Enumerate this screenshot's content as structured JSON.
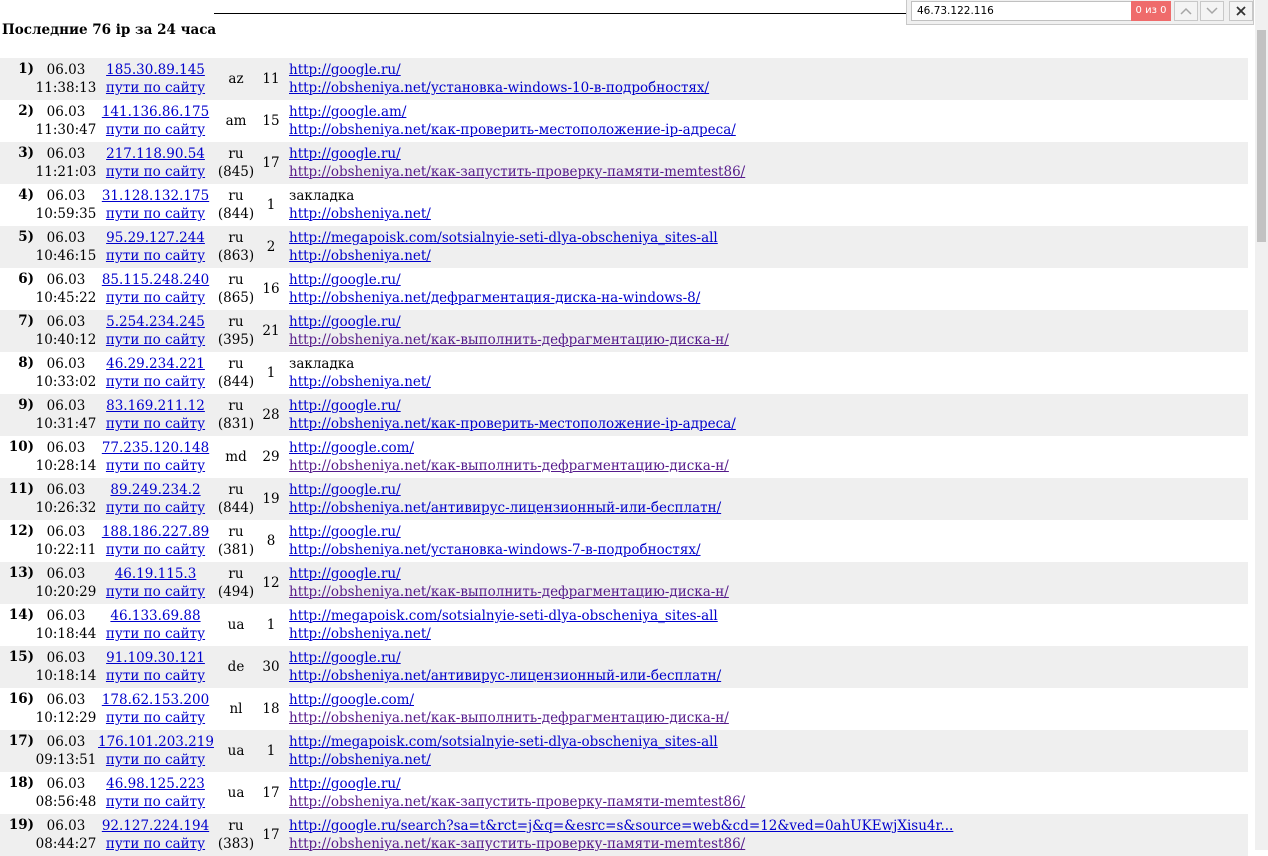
{
  "page": {
    "title": "Последние 76 ip за 24 часа"
  },
  "findbar": {
    "query": "46.73.122.116",
    "count": "0 из 0",
    "prev_icon": "chevron-up-icon",
    "next_icon": "chevron-down-icon",
    "close_icon": "close-icon"
  },
  "colors": {
    "link": "#0000cc",
    "visited": "#551a8b",
    "row_shade": "#efefef",
    "find_no_match": "#ef6b6b"
  },
  "rows": [
    {
      "num": "1)",
      "date": "06.03",
      "time": "11:38:13",
      "ip": "185.30.89.145",
      "paths": "пути по сайту",
      "cc": "az",
      "region": "",
      "count": "11",
      "ref1": "http://google.ru/",
      "ref1_link": true,
      "ref2": "http://obsheniya.net/установка-windows-10-в-подробностях/",
      "ref2_visited": false
    },
    {
      "num": "2)",
      "date": "06.03",
      "time": "11:30:47",
      "ip": "141.136.86.175",
      "paths": "пути по сайту",
      "cc": "am",
      "region": "",
      "count": "15",
      "ref1": "http://google.am/",
      "ref1_link": true,
      "ref2": "http://obsheniya.net/как-проверить-местоположение-ip-адреса/",
      "ref2_visited": false
    },
    {
      "num": "3)",
      "date": "06.03",
      "time": "11:21:03",
      "ip": "217.118.90.54",
      "paths": "пути по сайту",
      "cc": "ru",
      "region": "(845)",
      "count": "17",
      "ref1": "http://google.ru/",
      "ref1_link": true,
      "ref2": "http://obsheniya.net/как-запустить-проверку-памяти-memtest86/",
      "ref2_visited": true
    },
    {
      "num": "4)",
      "date": "06.03",
      "time": "10:59:35",
      "ip": "31.128.132.175",
      "paths": "пути по сайту",
      "cc": "ru",
      "region": "(844)",
      "count": "1",
      "ref1": "закладка",
      "ref1_link": false,
      "ref2": "http://obsheniya.net/",
      "ref2_visited": false
    },
    {
      "num": "5)",
      "date": "06.03",
      "time": "10:46:15",
      "ip": "95.29.127.244",
      "paths": "пути по сайту",
      "cc": "ru",
      "region": "(863)",
      "count": "2",
      "ref1": "http://megapoisk.com/sotsialnyie-seti-dlya-obscheniya_sites-all",
      "ref1_link": true,
      "ref2": "http://obsheniya.net/",
      "ref2_visited": false
    },
    {
      "num": "6)",
      "date": "06.03",
      "time": "10:45:22",
      "ip": "85.115.248.240",
      "paths": "пути по сайту",
      "cc": "ru",
      "region": "(865)",
      "count": "16",
      "ref1": "http://google.ru/",
      "ref1_link": true,
      "ref2": "http://obsheniya.net/дефрагментация-диска-на-windows-8/",
      "ref2_visited": false
    },
    {
      "num": "7)",
      "date": "06.03",
      "time": "10:40:12",
      "ip": "5.254.234.245",
      "paths": "пути по сайту",
      "cc": "ru",
      "region": "(395)",
      "count": "21",
      "ref1": "http://google.ru/",
      "ref1_link": true,
      "ref2": "http://obsheniya.net/как-выполнить-дефрагментацию-диска-н/",
      "ref2_visited": true
    },
    {
      "num": "8)",
      "date": "06.03",
      "time": "10:33:02",
      "ip": "46.29.234.221",
      "paths": "пути по сайту",
      "cc": "ru",
      "region": "(844)",
      "count": "1",
      "ref1": "закладка",
      "ref1_link": false,
      "ref2": "http://obsheniya.net/",
      "ref2_visited": false
    },
    {
      "num": "9)",
      "date": "06.03",
      "time": "10:31:47",
      "ip": "83.169.211.12",
      "paths": "пути по сайту",
      "cc": "ru",
      "region": "(831)",
      "count": "28",
      "ref1": "http://google.ru/",
      "ref1_link": true,
      "ref2": "http://obsheniya.net/как-проверить-местоположение-ip-адреса/",
      "ref2_visited": false
    },
    {
      "num": "10)",
      "date": "06.03",
      "time": "10:28:14",
      "ip": "77.235.120.148",
      "paths": "пути по сайту",
      "cc": "md",
      "region": "",
      "count": "29",
      "ref1": "http://google.com/",
      "ref1_link": true,
      "ref2": "http://obsheniya.net/как-выполнить-дефрагментацию-диска-н/",
      "ref2_visited": true
    },
    {
      "num": "11)",
      "date": "06.03",
      "time": "10:26:32",
      "ip": "89.249.234.2",
      "paths": "пути по сайту",
      "cc": "ru",
      "region": "(844)",
      "count": "19",
      "ref1": "http://google.ru/",
      "ref1_link": true,
      "ref2": "http://obsheniya.net/антивирус-лицензионный-или-бесплатн/",
      "ref2_visited": false
    },
    {
      "num": "12)",
      "date": "06.03",
      "time": "10:22:11",
      "ip": "188.186.227.89",
      "paths": "пути по сайту",
      "cc": "ru",
      "region": "(381)",
      "count": "8",
      "ref1": "http://google.ru/",
      "ref1_link": true,
      "ref2": "http://obsheniya.net/установка-windows-7-в-подробностях/",
      "ref2_visited": false
    },
    {
      "num": "13)",
      "date": "06.03",
      "time": "10:20:29",
      "ip": "46.19.115.3",
      "paths": "пути по сайту",
      "cc": "ru",
      "region": "(494)",
      "count": "12",
      "ref1": "http://google.ru/",
      "ref1_link": true,
      "ref2": "http://obsheniya.net/как-выполнить-дефрагментацию-диска-н/",
      "ref2_visited": true
    },
    {
      "num": "14)",
      "date": "06.03",
      "time": "10:18:44",
      "ip": "46.133.69.88",
      "paths": "пути по сайту",
      "cc": "ua",
      "region": "",
      "count": "1",
      "ref1": "http://megapoisk.com/sotsialnyie-seti-dlya-obscheniya_sites-all",
      "ref1_link": true,
      "ref2": "http://obsheniya.net/",
      "ref2_visited": false
    },
    {
      "num": "15)",
      "date": "06.03",
      "time": "10:18:14",
      "ip": "91.109.30.121",
      "paths": "пути по сайту",
      "cc": "de",
      "region": "",
      "count": "30",
      "ref1": "http://google.ru/",
      "ref1_link": true,
      "ref2": "http://obsheniya.net/антивирус-лицензионный-или-бесплатн/",
      "ref2_visited": false
    },
    {
      "num": "16)",
      "date": "06.03",
      "time": "10:12:29",
      "ip": "178.62.153.200",
      "paths": "пути по сайту",
      "cc": "nl",
      "region": "",
      "count": "18",
      "ref1": "http://google.com/",
      "ref1_link": true,
      "ref2": "http://obsheniya.net/как-выполнить-дефрагментацию-диска-н/",
      "ref2_visited": true
    },
    {
      "num": "17)",
      "date": "06.03",
      "time": "09:13:51",
      "ip": "176.101.203.219",
      "paths": "пути по сайту",
      "cc": "ua",
      "region": "",
      "count": "1",
      "ref1": "http://megapoisk.com/sotsialnyie-seti-dlya-obscheniya_sites-all",
      "ref1_link": true,
      "ref2": "http://obsheniya.net/",
      "ref2_visited": false
    },
    {
      "num": "18)",
      "date": "06.03",
      "time": "08:56:48",
      "ip": "46.98.125.223",
      "paths": "пути по сайту",
      "cc": "ua",
      "region": "",
      "count": "17",
      "ref1": "http://google.ru/",
      "ref1_link": true,
      "ref2": "http://obsheniya.net/как-запустить-проверку-памяти-memtest86/",
      "ref2_visited": true
    },
    {
      "num": "19)",
      "date": "06.03",
      "time": "08:44:27",
      "ip": "92.127.224.194",
      "paths": "пути по сайту",
      "cc": "ru",
      "region": "(383)",
      "count": "17",
      "ref1": "http://google.ru/search?sa=t&rct=j&q=&esrc=s&source=web&cd=12&ved=0ahUKEwjXisu4r...",
      "ref1_link": true,
      "ref2": "http://obsheniya.net/как-запустить-проверку-памяти-memtest86/",
      "ref2_visited": true
    }
  ]
}
